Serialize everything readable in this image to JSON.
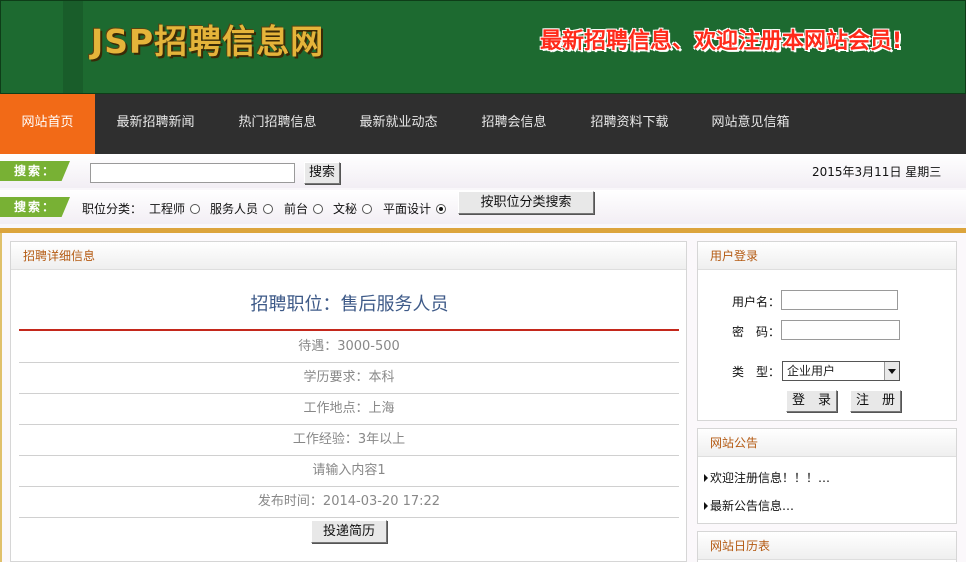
{
  "header": {
    "logo_text": "JSP招聘信息网",
    "slogan": "最新招聘信息、欢迎注册本网站会员!"
  },
  "nav": {
    "items": [
      {
        "label": "网站首页",
        "active": true
      },
      {
        "label": "最新招聘新闻"
      },
      {
        "label": "热门招聘信息"
      },
      {
        "label": "最新就业动态"
      },
      {
        "label": "招聘会信息"
      },
      {
        "label": "招聘资料下载"
      },
      {
        "label": "网站意见信箱"
      }
    ]
  },
  "search": {
    "tag_label": "搜索：",
    "keyword_value": "",
    "button_label": "搜索",
    "date_text": "2015年3月11日 星期三",
    "category_label": "职位分类：",
    "categories": [
      {
        "label": "工程师",
        "checked": false
      },
      {
        "label": "服务人员",
        "checked": false
      },
      {
        "label": "前台",
        "checked": false
      },
      {
        "label": "文秘",
        "checked": false
      },
      {
        "label": "平面设计",
        "checked": true
      }
    ],
    "category_button_label": "按职位分类搜索"
  },
  "detail": {
    "panel_title": "招聘详细信息",
    "job_title": "招聘职位：售后服务人员",
    "rows": [
      "待遇：3000-500",
      "学历要求：本科",
      "工作地点：上海",
      "工作经验：3年以上",
      "请输入内容1",
      "发布时间：2014-03-20 17:22"
    ],
    "apply_button": "投递简历"
  },
  "login": {
    "panel_title": "用户登录",
    "username_label": "用户名：",
    "username_value": "",
    "password_label": "密　码：",
    "password_value": "",
    "type_label": "类　型：",
    "type_value": "企业用户",
    "login_button": "登　录",
    "register_button": "注　册"
  },
  "notice": {
    "panel_title": "网站公告",
    "items": [
      "欢迎注册信息！！！…",
      "最新公告信息…"
    ]
  },
  "calendar": {
    "panel_title": "网站日历表"
  },
  "colors": {
    "header_green": "#1d6a30",
    "logo_gold": "#e5b43a",
    "slogan_red": "#ff2a1a",
    "nav_bg": "#2f2f2f",
    "nav_active": "#f26a17",
    "tag_green": "#78b134",
    "divider_red": "#c4281c",
    "panel_title": "#b45a12",
    "job_title_blue": "#3e5a88"
  }
}
